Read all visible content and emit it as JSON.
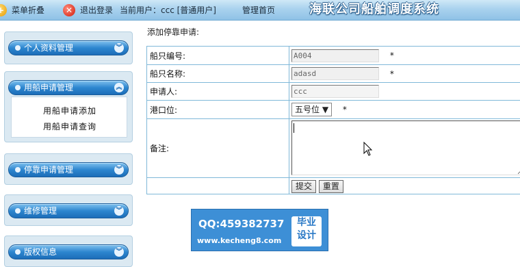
{
  "topbar": {
    "menu_toggle": "菜单折叠",
    "logout": "退出登录",
    "current_user_label": "当前用户：ccc [普通用户]",
    "home_link": "管理首页",
    "system_title": "海联公司船舶调度系统"
  },
  "sidebar": {
    "menus": [
      {
        "label": "个人资料管理"
      },
      {
        "label": "用船申请管理",
        "items": [
          "用船申请添加",
          "用船申请查询"
        ]
      },
      {
        "label": "停靠申请管理"
      },
      {
        "label": "维修管理"
      },
      {
        "label": "版权信息"
      }
    ]
  },
  "main": {
    "title": "添加停靠申请:",
    "fields": {
      "ship_no": {
        "label": "船只编号:",
        "value": "A004",
        "required": "*"
      },
      "ship_name": {
        "label": "船只名称:",
        "value": "adasd",
        "required": "*"
      },
      "applicant": {
        "label": "申请人:",
        "value": "ccc"
      },
      "berth": {
        "label": "港口位:",
        "value": "五号位 ▼",
        "required": "*"
      },
      "remark": {
        "label": "备注:"
      }
    },
    "buttons": {
      "submit": "提交",
      "reset": "重置"
    }
  },
  "watermark": {
    "qq": "QQ:459382737",
    "url": "www.kecheng8.com",
    "badge_line1": "毕业",
    "badge_line2": "设计"
  },
  "colors": {
    "topbar": "#a9d2ee",
    "menu_head": "#2d86cf",
    "table_border": "#7fb8d8",
    "watermark": "#3d8fd6"
  }
}
